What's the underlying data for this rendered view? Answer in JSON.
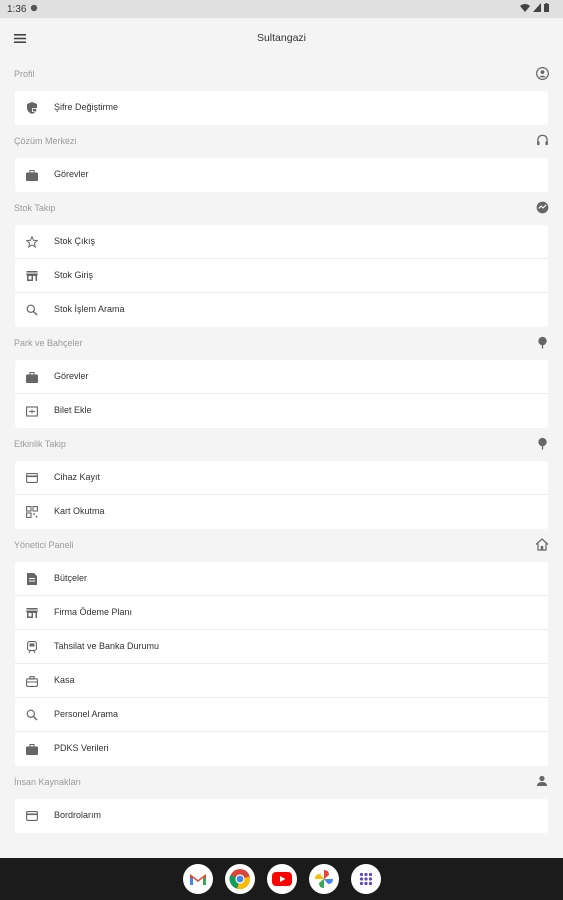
{
  "status_bar": {
    "time": "1:36"
  },
  "app_bar": {
    "title": "Sultangazi",
    "menu_icon": "menu-icon"
  },
  "sections": [
    {
      "title": "Profil",
      "icon": "account-circle-icon",
      "items": [
        {
          "label": "Şifre Değiştirme",
          "icon": "key-lock-icon"
        }
      ]
    },
    {
      "title": "Çözüm Merkezi",
      "icon": "headset-icon",
      "items": [
        {
          "label": "Görevler",
          "icon": "briefcase-icon"
        }
      ]
    },
    {
      "title": "Stok Takip",
      "icon": "stock-circle-icon",
      "items": [
        {
          "label": "Stok Çıkış",
          "icon": "star-outline-icon"
        },
        {
          "label": "Stok Giriş",
          "icon": "store-icon"
        },
        {
          "label": "Stok İşlem Arama",
          "icon": "search-icon"
        }
      ]
    },
    {
      "title": "Park ve Bahçeler",
      "icon": "tree-icon",
      "items": [
        {
          "label": "Görevler",
          "icon": "briefcase-icon"
        },
        {
          "label": "Bilet Ekle",
          "icon": "ticket-icon"
        }
      ]
    },
    {
      "title": "Etkinlik Takip",
      "icon": "tree-icon",
      "items": [
        {
          "label": "Cihaz Kayıt",
          "icon": "card-icon"
        },
        {
          "label": "Kart Okutma",
          "icon": "qr-icon"
        }
      ]
    },
    {
      "title": "Yönetici Paneli",
      "icon": "home-outline-icon",
      "items": [
        {
          "label": "Bütçeler",
          "icon": "document-icon"
        },
        {
          "label": "Firma Ödeme Planı",
          "icon": "store-icon"
        },
        {
          "label": "Tahsilat ve Banka Durumu",
          "icon": "train-icon"
        },
        {
          "label": "Kasa",
          "icon": "briefcase-outline-icon"
        },
        {
          "label": "Personel Arama",
          "icon": "search-icon"
        },
        {
          "label": "PDKS Verileri",
          "icon": "briefcase-icon"
        }
      ]
    },
    {
      "title": "İnsan Kaynakları",
      "icon": "person-icon",
      "items": [
        {
          "label": "Bordrolarım",
          "icon": "card-icon"
        }
      ]
    }
  ],
  "dock": [
    {
      "name": "gmail-icon",
      "color": "#EA4335"
    },
    {
      "name": "chrome-icon",
      "color": "#4285F4"
    },
    {
      "name": "youtube-icon",
      "color": "#FF0000"
    },
    {
      "name": "photos-icon",
      "color": "#FBBC05"
    },
    {
      "name": "apps-grid-icon",
      "color": "#5F46C8"
    }
  ]
}
